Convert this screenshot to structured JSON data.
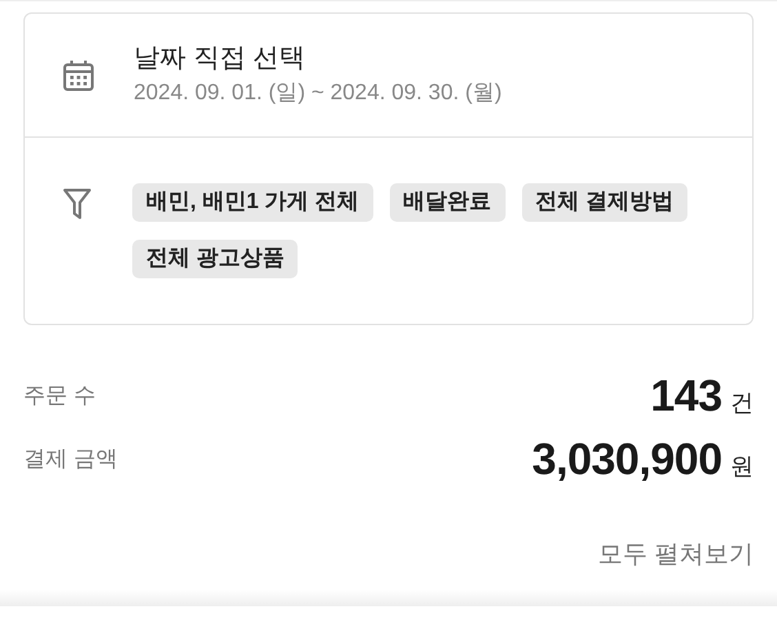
{
  "date_filter": {
    "title": "날짜 직접 선택",
    "range": "2024. 09. 01. (일) ~ 2024. 09. 30. (월)"
  },
  "filter_chips": [
    "배민, 배민1 가게 전체",
    "배달완료",
    "전체 결제방법",
    "전체 광고상품"
  ],
  "summary": [
    {
      "label": "주문 수",
      "value": "143",
      "unit": "건"
    },
    {
      "label": "결제 금액",
      "value": "3,030,900",
      "unit": "원"
    }
  ],
  "expand_link": "모두 펼쳐보기"
}
